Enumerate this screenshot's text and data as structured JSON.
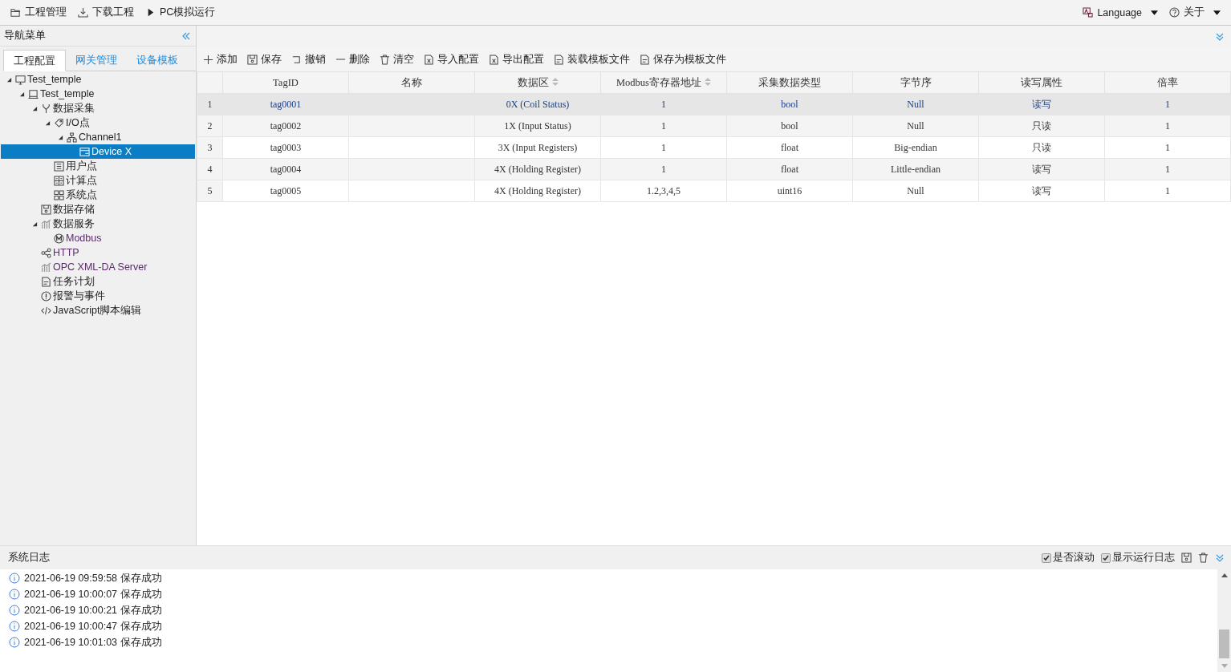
{
  "menu_bar": {
    "left": [
      {
        "label": "工程管理",
        "kind": "folder"
      },
      {
        "label": "下载工程",
        "kind": "download"
      },
      {
        "label": "PC模拟运行",
        "kind": "play"
      }
    ],
    "right": [
      {
        "label": "Language",
        "kind": "language"
      },
      {
        "label": "关于",
        "kind": "help"
      }
    ]
  },
  "sidebar": {
    "title": "导航菜单",
    "tabs": [
      {
        "label": "工程配置",
        "selected": true
      },
      {
        "label": "网关管理",
        "selected": false
      },
      {
        "label": "设备模板",
        "selected": false
      }
    ],
    "tree": [
      {
        "label": "Test_temple",
        "kind": "monitor",
        "expanded": true,
        "selected": false,
        "children": [
          {
            "label": "Test_temple",
            "kind": "laptop",
            "expanded": true,
            "selected": false,
            "children": [
              {
                "label": "数据采集",
                "kind": "branch",
                "expanded": true,
                "selected": false,
                "children": [
                  {
                    "label": "I/O点",
                    "kind": "tag",
                    "expanded": true,
                    "selected": false,
                    "children": [
                      {
                        "label": "Channel1",
                        "kind": "network",
                        "expanded": true,
                        "selected": false,
                        "children": [
                          {
                            "label": "Device X",
                            "kind": "device",
                            "selected": true
                          }
                        ]
                      }
                    ]
                  },
                  {
                    "label": "用户点",
                    "kind": "list",
                    "selected": false
                  },
                  {
                    "label": "计算点",
                    "kind": "calc",
                    "selected": false
                  },
                  {
                    "label": "系统点",
                    "kind": "grid",
                    "selected": false
                  }
                ]
              },
              {
                "label": "数据存储",
                "kind": "disk",
                "selected": false
              },
              {
                "label": "数据服务",
                "kind": "chart",
                "expanded": true,
                "selected": false,
                "children": [
                  {
                    "label": "Modbus",
                    "kind": "modbus",
                    "selected": false,
                    "link": true
                  }
                ]
              },
              {
                "label": "HTTP",
                "kind": "share",
                "selected": false,
                "link": true
              },
              {
                "label": "OPC XML-DA Server",
                "kind": "chart",
                "selected": false,
                "link": true
              },
              {
                "label": "任务计划",
                "kind": "doc",
                "selected": false
              },
              {
                "label": "报警与事件",
                "kind": "alert",
                "selected": false
              },
              {
                "label": "JavaScript脚本编辑",
                "kind": "code",
                "selected": false
              }
            ]
          }
        ]
      }
    ]
  },
  "toolbar": [
    {
      "label": "添加",
      "kind": "plus"
    },
    {
      "label": "保存",
      "kind": "save"
    },
    {
      "label": "撤销",
      "kind": "undo"
    },
    {
      "label": "删除",
      "kind": "minus"
    },
    {
      "label": "清空",
      "kind": "trash"
    },
    {
      "label": "导入配置",
      "kind": "excel"
    },
    {
      "label": "导出配置",
      "kind": "excel"
    },
    {
      "label": "装载模板文件",
      "kind": "doc"
    },
    {
      "label": "保存为模板文件",
      "kind": "doc"
    }
  ],
  "table": {
    "columns": [
      {
        "label": "TagID",
        "sortable": false
      },
      {
        "label": "名称",
        "sortable": false
      },
      {
        "label": "数据区",
        "sortable": true
      },
      {
        "label": "Modbus寄存器地址",
        "sortable": true
      },
      {
        "label": "采集数据类型",
        "sortable": false
      },
      {
        "label": "字节序",
        "sortable": false
      },
      {
        "label": "读写属性",
        "sortable": false
      },
      {
        "label": "倍率",
        "sortable": false
      }
    ],
    "rows": [
      {
        "number": "1",
        "selected": true,
        "cells": [
          "tag0001",
          null,
          "0X (Coil Status)",
          "1",
          "bool",
          "Null",
          "读写",
          "1"
        ]
      },
      {
        "number": "2",
        "selected": false,
        "cells": [
          "tag0002",
          null,
          "1X (Input Status)",
          "1",
          "bool",
          "Null",
          "只读",
          "1"
        ]
      },
      {
        "number": "3",
        "selected": false,
        "cells": [
          "tag0003",
          null,
          "3X (Input Registers)",
          "1",
          "float",
          "Big-endian",
          "只读",
          "1"
        ]
      },
      {
        "number": "4",
        "selected": false,
        "cells": [
          "tag0004",
          null,
          "4X (Holding Register)",
          "1",
          "float",
          "Little-endian",
          "读写",
          "1"
        ]
      },
      {
        "number": "5",
        "selected": false,
        "cells": [
          "tag0005",
          null,
          "4X (Holding Register)",
          "1.2,3,4,5",
          "uint16",
          "Null",
          "读写",
          "1"
        ]
      }
    ]
  },
  "log": {
    "title": "系统日志",
    "options": [
      {
        "label": "是否滚动",
        "checked": true
      },
      {
        "label": "显示运行日志",
        "checked": true
      }
    ],
    "entries": [
      "2021-06-19 09:59:58 保存成功",
      "2021-06-19 10:00:07 保存成功",
      "2021-06-19 10:00:21 保存成功",
      "2021-06-19 10:00:47 保存成功",
      "2021-06-19 10:01:03 保存成功"
    ]
  }
}
